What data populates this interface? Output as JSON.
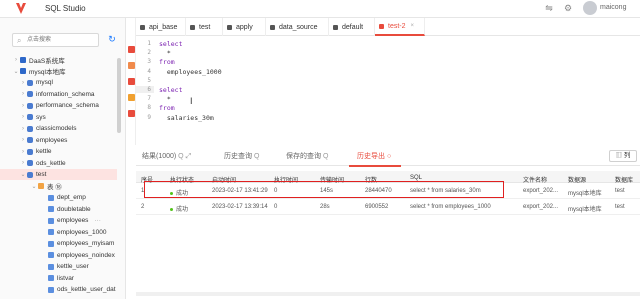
{
  "app": {
    "title": "SQL Studio",
    "username": "maicong"
  },
  "sidebar": {
    "search_placeholder": "点击搜索",
    "tree": [
      {
        "label": "DaaS系统库",
        "level": 0,
        "expanded": false,
        "kind": "srv"
      },
      {
        "label": "mysql本地库",
        "level": 0,
        "expanded": true,
        "kind": "srv"
      },
      {
        "label": "mysql",
        "level": 1,
        "kind": "db"
      },
      {
        "label": "information_schema",
        "level": 1,
        "kind": "db"
      },
      {
        "label": "performance_schema",
        "level": 1,
        "kind": "db"
      },
      {
        "label": "sys",
        "level": 1,
        "kind": "db"
      },
      {
        "label": "classicmodels",
        "level": 1,
        "kind": "db"
      },
      {
        "label": "employees",
        "level": 1,
        "kind": "db"
      },
      {
        "label": "kettle",
        "level": 1,
        "kind": "db"
      },
      {
        "label": "ods_kettle",
        "level": 1,
        "kind": "db"
      },
      {
        "label": "test",
        "level": 1,
        "kind": "db",
        "selected": true,
        "expanded": true
      },
      {
        "label": "表 ⑱",
        "level": 2,
        "kind": "folder",
        "expanded": true
      },
      {
        "label": "dept_emp",
        "level": 3,
        "kind": "tbl"
      },
      {
        "label": "doubletable",
        "level": 3,
        "kind": "tbl"
      },
      {
        "label": "employees",
        "level": 3,
        "kind": "tbl",
        "more": "···"
      },
      {
        "label": "employees_1000",
        "level": 3,
        "kind": "tbl"
      },
      {
        "label": "employees_myisam",
        "level": 3,
        "kind": "tbl"
      },
      {
        "label": "employees_noindex",
        "level": 3,
        "kind": "tbl"
      },
      {
        "label": "kettle_user",
        "level": 3,
        "kind": "tbl"
      },
      {
        "label": "listvar",
        "level": 3,
        "kind": "tbl"
      },
      {
        "label": "ods_kettle_user_dat",
        "level": 3,
        "kind": "tbl"
      }
    ]
  },
  "tabs": [
    {
      "label": "api_base",
      "active": false
    },
    {
      "label": "test",
      "active": false
    },
    {
      "label": "apply",
      "active": false
    },
    {
      "label": "data_source",
      "active": false
    },
    {
      "label": "default",
      "active": false
    },
    {
      "label": "test-2",
      "active": true,
      "close": "×"
    }
  ],
  "editor": {
    "lines": [
      {
        "n": "1",
        "parts": [
          [
            "kw",
            "select"
          ]
        ]
      },
      {
        "n": "2",
        "parts": [
          [
            "plain",
            "  *"
          ]
        ]
      },
      {
        "n": "3",
        "parts": [
          [
            "kw",
            "from"
          ]
        ]
      },
      {
        "n": "4",
        "parts": [
          [
            "plain",
            "  employees_1000"
          ]
        ]
      },
      {
        "n": "5",
        "parts": []
      },
      {
        "n": "6",
        "parts": [
          [
            "kw",
            "select"
          ]
        ]
      },
      {
        "n": "7",
        "parts": [
          [
            "plain",
            "  *"
          ]
        ]
      },
      {
        "n": "8",
        "parts": [
          [
            "kw",
            "from"
          ]
        ]
      },
      {
        "n": "9",
        "parts": [
          [
            "plain",
            "  salaries_30m"
          ]
        ]
      }
    ]
  },
  "results": {
    "tabs": [
      {
        "label": "结果(1000)",
        "icons": "Q ⤢"
      },
      {
        "label": "历史查询",
        "icons": "Q"
      },
      {
        "label": "保存的查询",
        "icons": "Q"
      },
      {
        "label": "历史导出",
        "icons": "○",
        "active": true
      }
    ],
    "column_button": "列",
    "columns": [
      "序号",
      "执行状态",
      "启动时间",
      "执行时间",
      "传输时间",
      "行数",
      "SQL",
      "文件名称",
      "数据源",
      "数据库"
    ],
    "rows": [
      [
        "1",
        "成功",
        "2023-02-17 13:41:29",
        "0",
        "145s",
        "28440470",
        "select * from salaries_30m",
        "export_202...",
        "mysql本地库",
        "test"
      ],
      [
        "2",
        "成功",
        "2023-02-17 13:39:14",
        "0",
        "28s",
        "6900552",
        "select * from employees_1000",
        "export_202...",
        "mysql本地库",
        "test"
      ]
    ]
  },
  "colors": {
    "accent": "#e84b3c",
    "success": "#52c41a",
    "highlight_border": "#e02020"
  }
}
